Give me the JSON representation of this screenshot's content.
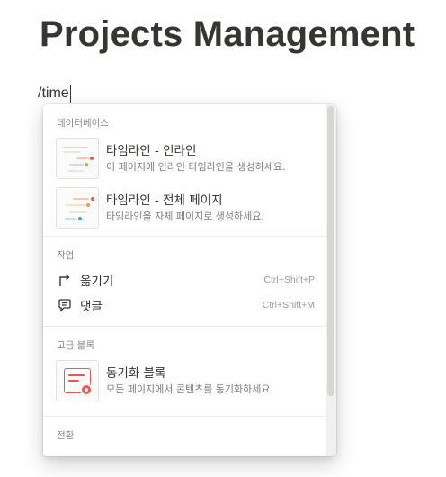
{
  "page": {
    "title": "Projects Management",
    "command_text": "/time"
  },
  "menu": {
    "sections": {
      "database": {
        "header": "데이터베이스",
        "items": [
          {
            "title": "타임라인 - 인라인",
            "desc": "이 페이지에 인라인 타임라인을 생성하세요.",
            "icon": "timeline-inline-icon"
          },
          {
            "title": "타임라인 - 전체 페이지",
            "desc": "타임라인을 자체 페이지로 생성하세요.",
            "icon": "timeline-fullpage-icon"
          }
        ]
      },
      "actions": {
        "header": "작업",
        "items": [
          {
            "label": "옮기기",
            "shortcut": "Ctrl+Shift+P",
            "icon": "move-to-icon"
          },
          {
            "label": "댓글",
            "shortcut": "Ctrl+Shift+M",
            "icon": "comment-icon"
          }
        ]
      },
      "advanced": {
        "header": "고급 블록",
        "items": [
          {
            "title": "동기화 블록",
            "desc": "모든 페이지에서 콘텐츠를 동기화하세요.",
            "icon": "synced-block-icon"
          }
        ]
      },
      "turn_into": {
        "header": "전환"
      }
    }
  },
  "colors": {
    "text": "#37352f",
    "muted": "#8a8985",
    "accent_red": "#eb5757",
    "accent_orange": "#f2994a",
    "accent_blue": "#2eaadc"
  }
}
